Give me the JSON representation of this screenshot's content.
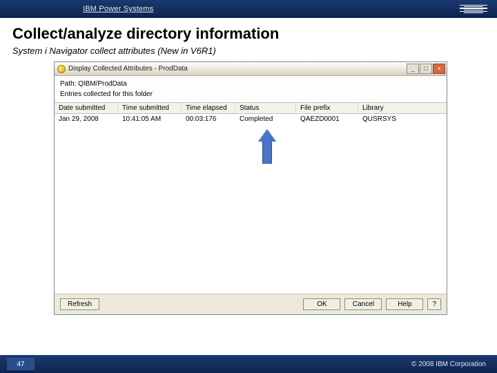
{
  "header": {
    "brand": "IBM Power Systems"
  },
  "slide": {
    "title": "Collect/analyze directory information",
    "subtitle": "System i Navigator collect attributes (New in V6R1)"
  },
  "window": {
    "title": "Display Collected Attributes - ProdData",
    "path_label": "Path: QIBM/ProdData",
    "entries_label": "Entries collected for this folder",
    "columns": {
      "date_submitted": "Date submitted",
      "time_submitted": "Time submitted",
      "time_elapsed": "Time elapsed",
      "status": "Status",
      "file_prefix": "File prefix",
      "library": "Library"
    },
    "rows": [
      {
        "date_submitted": "Jan 29, 2008",
        "time_submitted": "10:41:05 AM",
        "time_elapsed": "00:03:176",
        "status": "Completed",
        "file_prefix": "QAEZD0001",
        "library": "QUSRSYS"
      }
    ],
    "buttons": {
      "refresh": "Refresh",
      "ok": "OK",
      "cancel": "Cancel",
      "help": "Help",
      "qmark": "?"
    }
  },
  "footer": {
    "page": "47",
    "copyright": "© 2008 IBM Corporation"
  }
}
